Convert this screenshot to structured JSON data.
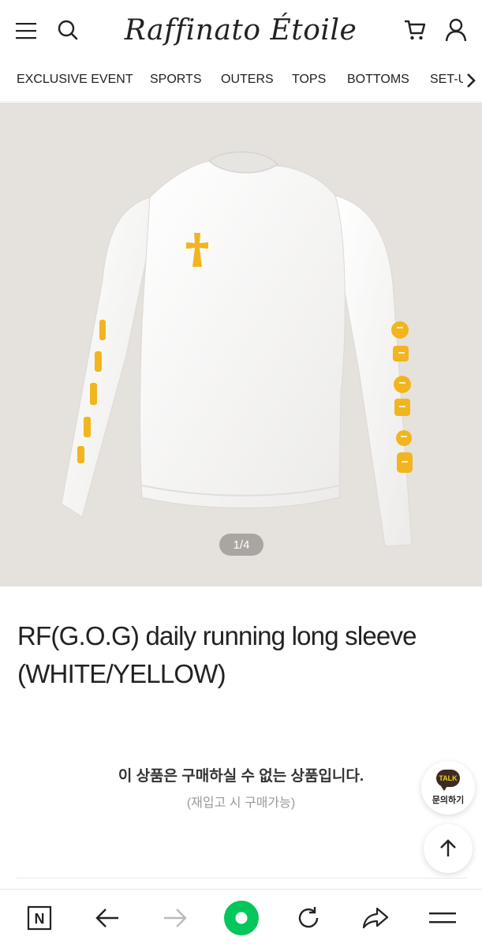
{
  "header": {
    "logo_text": "Raffinato Étoile",
    "icons": [
      "menu-icon",
      "search-icon",
      "cart-icon",
      "user-icon"
    ]
  },
  "nav": {
    "items": [
      {
        "label": "EXCLUSIVE EVENT"
      },
      {
        "label": "SPORTS"
      },
      {
        "label": "OUTERS"
      },
      {
        "label": "TOPS"
      },
      {
        "label": "BOTTOMS"
      },
      {
        "label": "SET-U"
      }
    ],
    "more_icon": "chevron-right-icon"
  },
  "product": {
    "image_counter": "1/4",
    "title": "RF(G.O.G) daily running long sleeve (WHITE/YELLOW)",
    "unavailable_message": "이 상품은 구매하실 수 없는 상품입니다.",
    "restock_note": "(재입고 시 구매가능)"
  },
  "floating": {
    "talk_badge": "TALK",
    "talk_label": "문의하기",
    "top_icon": "arrow-up-icon"
  },
  "browser_bar": {
    "icons": [
      "naver-n-icon",
      "back-arrow-icon",
      "forward-arrow-icon",
      "home-green-dot-icon",
      "refresh-icon",
      "share-icon",
      "menu-icon"
    ],
    "brand_letter": "N"
  },
  "colors": {
    "hero_background": "#e5e1dc",
    "shirt": "#f8f8f7",
    "print_yellow": "#f2b51f",
    "accent_green": "#03c75a",
    "kakao_brown": "#3c2b25"
  }
}
